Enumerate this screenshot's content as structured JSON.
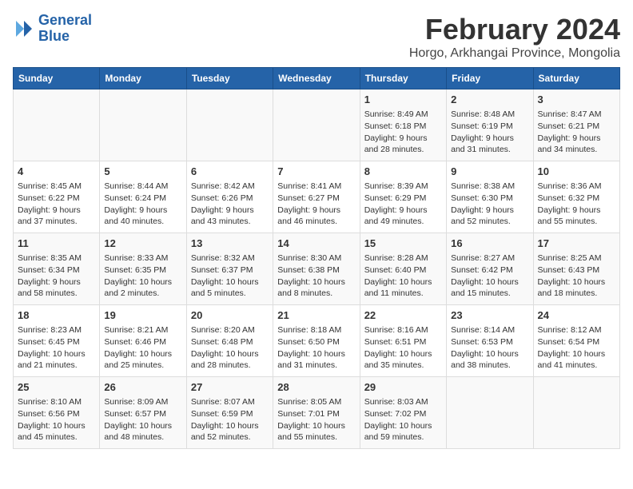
{
  "header": {
    "logo_line1": "General",
    "logo_line2": "Blue",
    "title": "February 2024",
    "subtitle": "Horgo, Arkhangai Province, Mongolia"
  },
  "weekdays": [
    "Sunday",
    "Monday",
    "Tuesday",
    "Wednesday",
    "Thursday",
    "Friday",
    "Saturday"
  ],
  "weeks": [
    [
      {
        "day": "",
        "text": ""
      },
      {
        "day": "",
        "text": ""
      },
      {
        "day": "",
        "text": ""
      },
      {
        "day": "",
        "text": ""
      },
      {
        "day": "1",
        "text": "Sunrise: 8:49 AM\nSunset: 6:18 PM\nDaylight: 9 hours\nand 28 minutes."
      },
      {
        "day": "2",
        "text": "Sunrise: 8:48 AM\nSunset: 6:19 PM\nDaylight: 9 hours\nand 31 minutes."
      },
      {
        "day": "3",
        "text": "Sunrise: 8:47 AM\nSunset: 6:21 PM\nDaylight: 9 hours\nand 34 minutes."
      }
    ],
    [
      {
        "day": "4",
        "text": "Sunrise: 8:45 AM\nSunset: 6:22 PM\nDaylight: 9 hours\nand 37 minutes."
      },
      {
        "day": "5",
        "text": "Sunrise: 8:44 AM\nSunset: 6:24 PM\nDaylight: 9 hours\nand 40 minutes."
      },
      {
        "day": "6",
        "text": "Sunrise: 8:42 AM\nSunset: 6:26 PM\nDaylight: 9 hours\nand 43 minutes."
      },
      {
        "day": "7",
        "text": "Sunrise: 8:41 AM\nSunset: 6:27 PM\nDaylight: 9 hours\nand 46 minutes."
      },
      {
        "day": "8",
        "text": "Sunrise: 8:39 AM\nSunset: 6:29 PM\nDaylight: 9 hours\nand 49 minutes."
      },
      {
        "day": "9",
        "text": "Sunrise: 8:38 AM\nSunset: 6:30 PM\nDaylight: 9 hours\nand 52 minutes."
      },
      {
        "day": "10",
        "text": "Sunrise: 8:36 AM\nSunset: 6:32 PM\nDaylight: 9 hours\nand 55 minutes."
      }
    ],
    [
      {
        "day": "11",
        "text": "Sunrise: 8:35 AM\nSunset: 6:34 PM\nDaylight: 9 hours\nand 58 minutes."
      },
      {
        "day": "12",
        "text": "Sunrise: 8:33 AM\nSunset: 6:35 PM\nDaylight: 10 hours\nand 2 minutes."
      },
      {
        "day": "13",
        "text": "Sunrise: 8:32 AM\nSunset: 6:37 PM\nDaylight: 10 hours\nand 5 minutes."
      },
      {
        "day": "14",
        "text": "Sunrise: 8:30 AM\nSunset: 6:38 PM\nDaylight: 10 hours\nand 8 minutes."
      },
      {
        "day": "15",
        "text": "Sunrise: 8:28 AM\nSunset: 6:40 PM\nDaylight: 10 hours\nand 11 minutes."
      },
      {
        "day": "16",
        "text": "Sunrise: 8:27 AM\nSunset: 6:42 PM\nDaylight: 10 hours\nand 15 minutes."
      },
      {
        "day": "17",
        "text": "Sunrise: 8:25 AM\nSunset: 6:43 PM\nDaylight: 10 hours\nand 18 minutes."
      }
    ],
    [
      {
        "day": "18",
        "text": "Sunrise: 8:23 AM\nSunset: 6:45 PM\nDaylight: 10 hours\nand 21 minutes."
      },
      {
        "day": "19",
        "text": "Sunrise: 8:21 AM\nSunset: 6:46 PM\nDaylight: 10 hours\nand 25 minutes."
      },
      {
        "day": "20",
        "text": "Sunrise: 8:20 AM\nSunset: 6:48 PM\nDaylight: 10 hours\nand 28 minutes."
      },
      {
        "day": "21",
        "text": "Sunrise: 8:18 AM\nSunset: 6:50 PM\nDaylight: 10 hours\nand 31 minutes."
      },
      {
        "day": "22",
        "text": "Sunrise: 8:16 AM\nSunset: 6:51 PM\nDaylight: 10 hours\nand 35 minutes."
      },
      {
        "day": "23",
        "text": "Sunrise: 8:14 AM\nSunset: 6:53 PM\nDaylight: 10 hours\nand 38 minutes."
      },
      {
        "day": "24",
        "text": "Sunrise: 8:12 AM\nSunset: 6:54 PM\nDaylight: 10 hours\nand 41 minutes."
      }
    ],
    [
      {
        "day": "25",
        "text": "Sunrise: 8:10 AM\nSunset: 6:56 PM\nDaylight: 10 hours\nand 45 minutes."
      },
      {
        "day": "26",
        "text": "Sunrise: 8:09 AM\nSunset: 6:57 PM\nDaylight: 10 hours\nand 48 minutes."
      },
      {
        "day": "27",
        "text": "Sunrise: 8:07 AM\nSunset: 6:59 PM\nDaylight: 10 hours\nand 52 minutes."
      },
      {
        "day": "28",
        "text": "Sunrise: 8:05 AM\nSunset: 7:01 PM\nDaylight: 10 hours\nand 55 minutes."
      },
      {
        "day": "29",
        "text": "Sunrise: 8:03 AM\nSunset: 7:02 PM\nDaylight: 10 hours\nand 59 minutes."
      },
      {
        "day": "",
        "text": ""
      },
      {
        "day": "",
        "text": ""
      }
    ]
  ]
}
